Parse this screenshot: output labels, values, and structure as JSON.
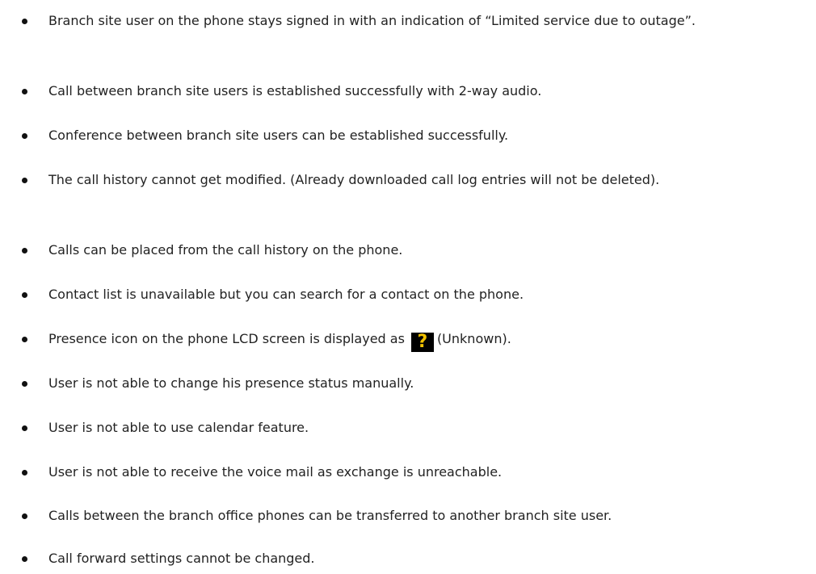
{
  "bullets": [
    "Branch site user on the phone stays signed in with an indication of “Limited service due to outage”.",
    "Call between branch site users is established successfully with 2-way audio.",
    "Conference between branch site users can be established successfully.",
    "The call history cannot get modified. (Already downloaded call log entries will not be deleted).",
    "Calls can be placed from the call history on the phone.",
    "Contact list is unavailable but you can search for a contact on the phone.",
    {
      "before": "Presence icon on the phone LCD screen is displayed as",
      "icon_glyph": "?",
      "icon_name": "presence-unknown-icon",
      "after": "(Unknown)."
    },
    "User is not able to change his presence status manually.",
    "User is not able to use calendar feature.",
    "User is not able to receive the voice mail as exchange is unreachable.",
    "Calls between the branch office phones can be transferred to another branch site user.",
    "Call forward settings cannot be changed."
  ],
  "colors": {
    "icon_background": "#000000",
    "icon_glyph": "#f2c200"
  }
}
